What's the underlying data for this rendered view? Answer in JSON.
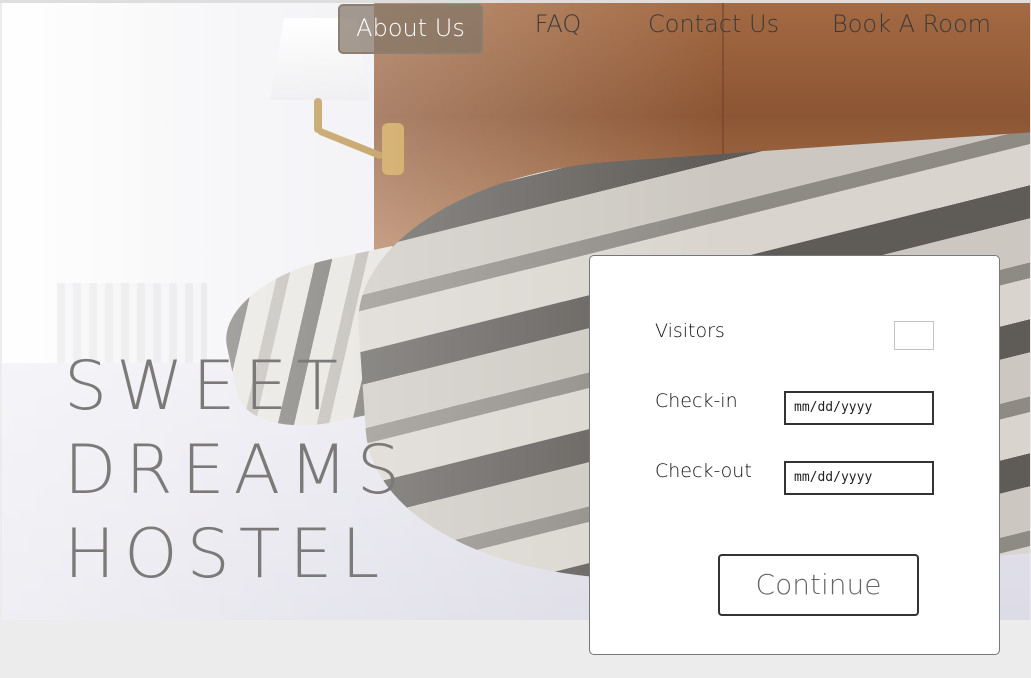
{
  "nav": {
    "items": [
      {
        "label": "About Us",
        "active": true
      },
      {
        "label": "FAQ",
        "active": false
      },
      {
        "label": "Contact Us",
        "active": false
      },
      {
        "label": "Book A Room",
        "active": false
      }
    ]
  },
  "hero": {
    "title_lines": [
      "SWEET",
      "DREAMS",
      "HOSTEL"
    ]
  },
  "booking": {
    "visitors_label": "Visitors",
    "visitors_value": "",
    "checkin_label": "Check-in",
    "checkin_placeholder": "mm/dd/yyyy",
    "checkout_label": "Check-out",
    "checkout_placeholder": "mm/dd/yyyy",
    "continue_label": "Continue"
  },
  "colors": {
    "nav_active_bg": "#82746699",
    "title_text": "#7c7a78",
    "page_bg": "#ececec"
  }
}
